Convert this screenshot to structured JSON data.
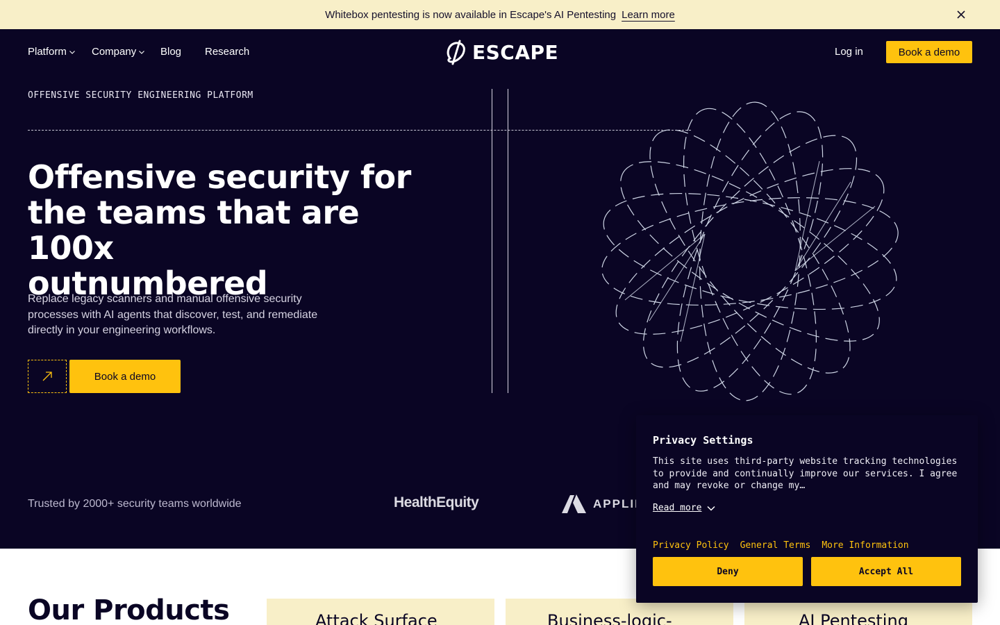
{
  "announcement": {
    "text": "Whitebox pentesting is now available in Escape's AI Pentesting",
    "link": "Learn more"
  },
  "nav": {
    "items": [
      {
        "label": "Platform",
        "dropdown": true
      },
      {
        "label": "Company",
        "dropdown": true
      },
      {
        "label": "Blog",
        "dropdown": false
      },
      {
        "label": "Research",
        "dropdown": false
      }
    ],
    "logo": "ESCAPE",
    "login": "Log in",
    "demo": "Book a demo"
  },
  "hero": {
    "eyebrow": "OFFENSIVE SECURITY ENGINEERING PLATFORM",
    "headline_lines": [
      "Offensive security for",
      "the teams that are 100x",
      "outnumbered"
    ],
    "subcopy": "Replace legacy scanners and manual offensive security processes with AI agents that discover, test, and remediate directly in your engineering workflows.",
    "cta": "Book a demo"
  },
  "trusted": {
    "text": "Trusted by 2000+ security teams worldwide",
    "logos": [
      "HealthEquity",
      "APPLIED"
    ]
  },
  "products": {
    "title": "Our Products",
    "cards": [
      "Attack Surface",
      "Business-logic-",
      "AI Pentesting"
    ]
  },
  "privacy": {
    "title": "Privacy Settings",
    "body": "This site uses third-party website tracking technologies to provide and continually improve our services. I agree and may revoke or change my…",
    "read_more": "Read more",
    "links": [
      "Privacy Policy",
      "General Terms",
      "More Information"
    ],
    "deny": "Deny",
    "accept": "Accept All"
  },
  "colors": {
    "accent": "#ffc20e",
    "hero_bg": "#0a0524",
    "banner_bg": "#f8efc8"
  },
  "icons": [
    "close-icon",
    "chevron-down-icon",
    "arrow-up-right-icon",
    "escape-logo-icon",
    "applied-logo-icon"
  ]
}
